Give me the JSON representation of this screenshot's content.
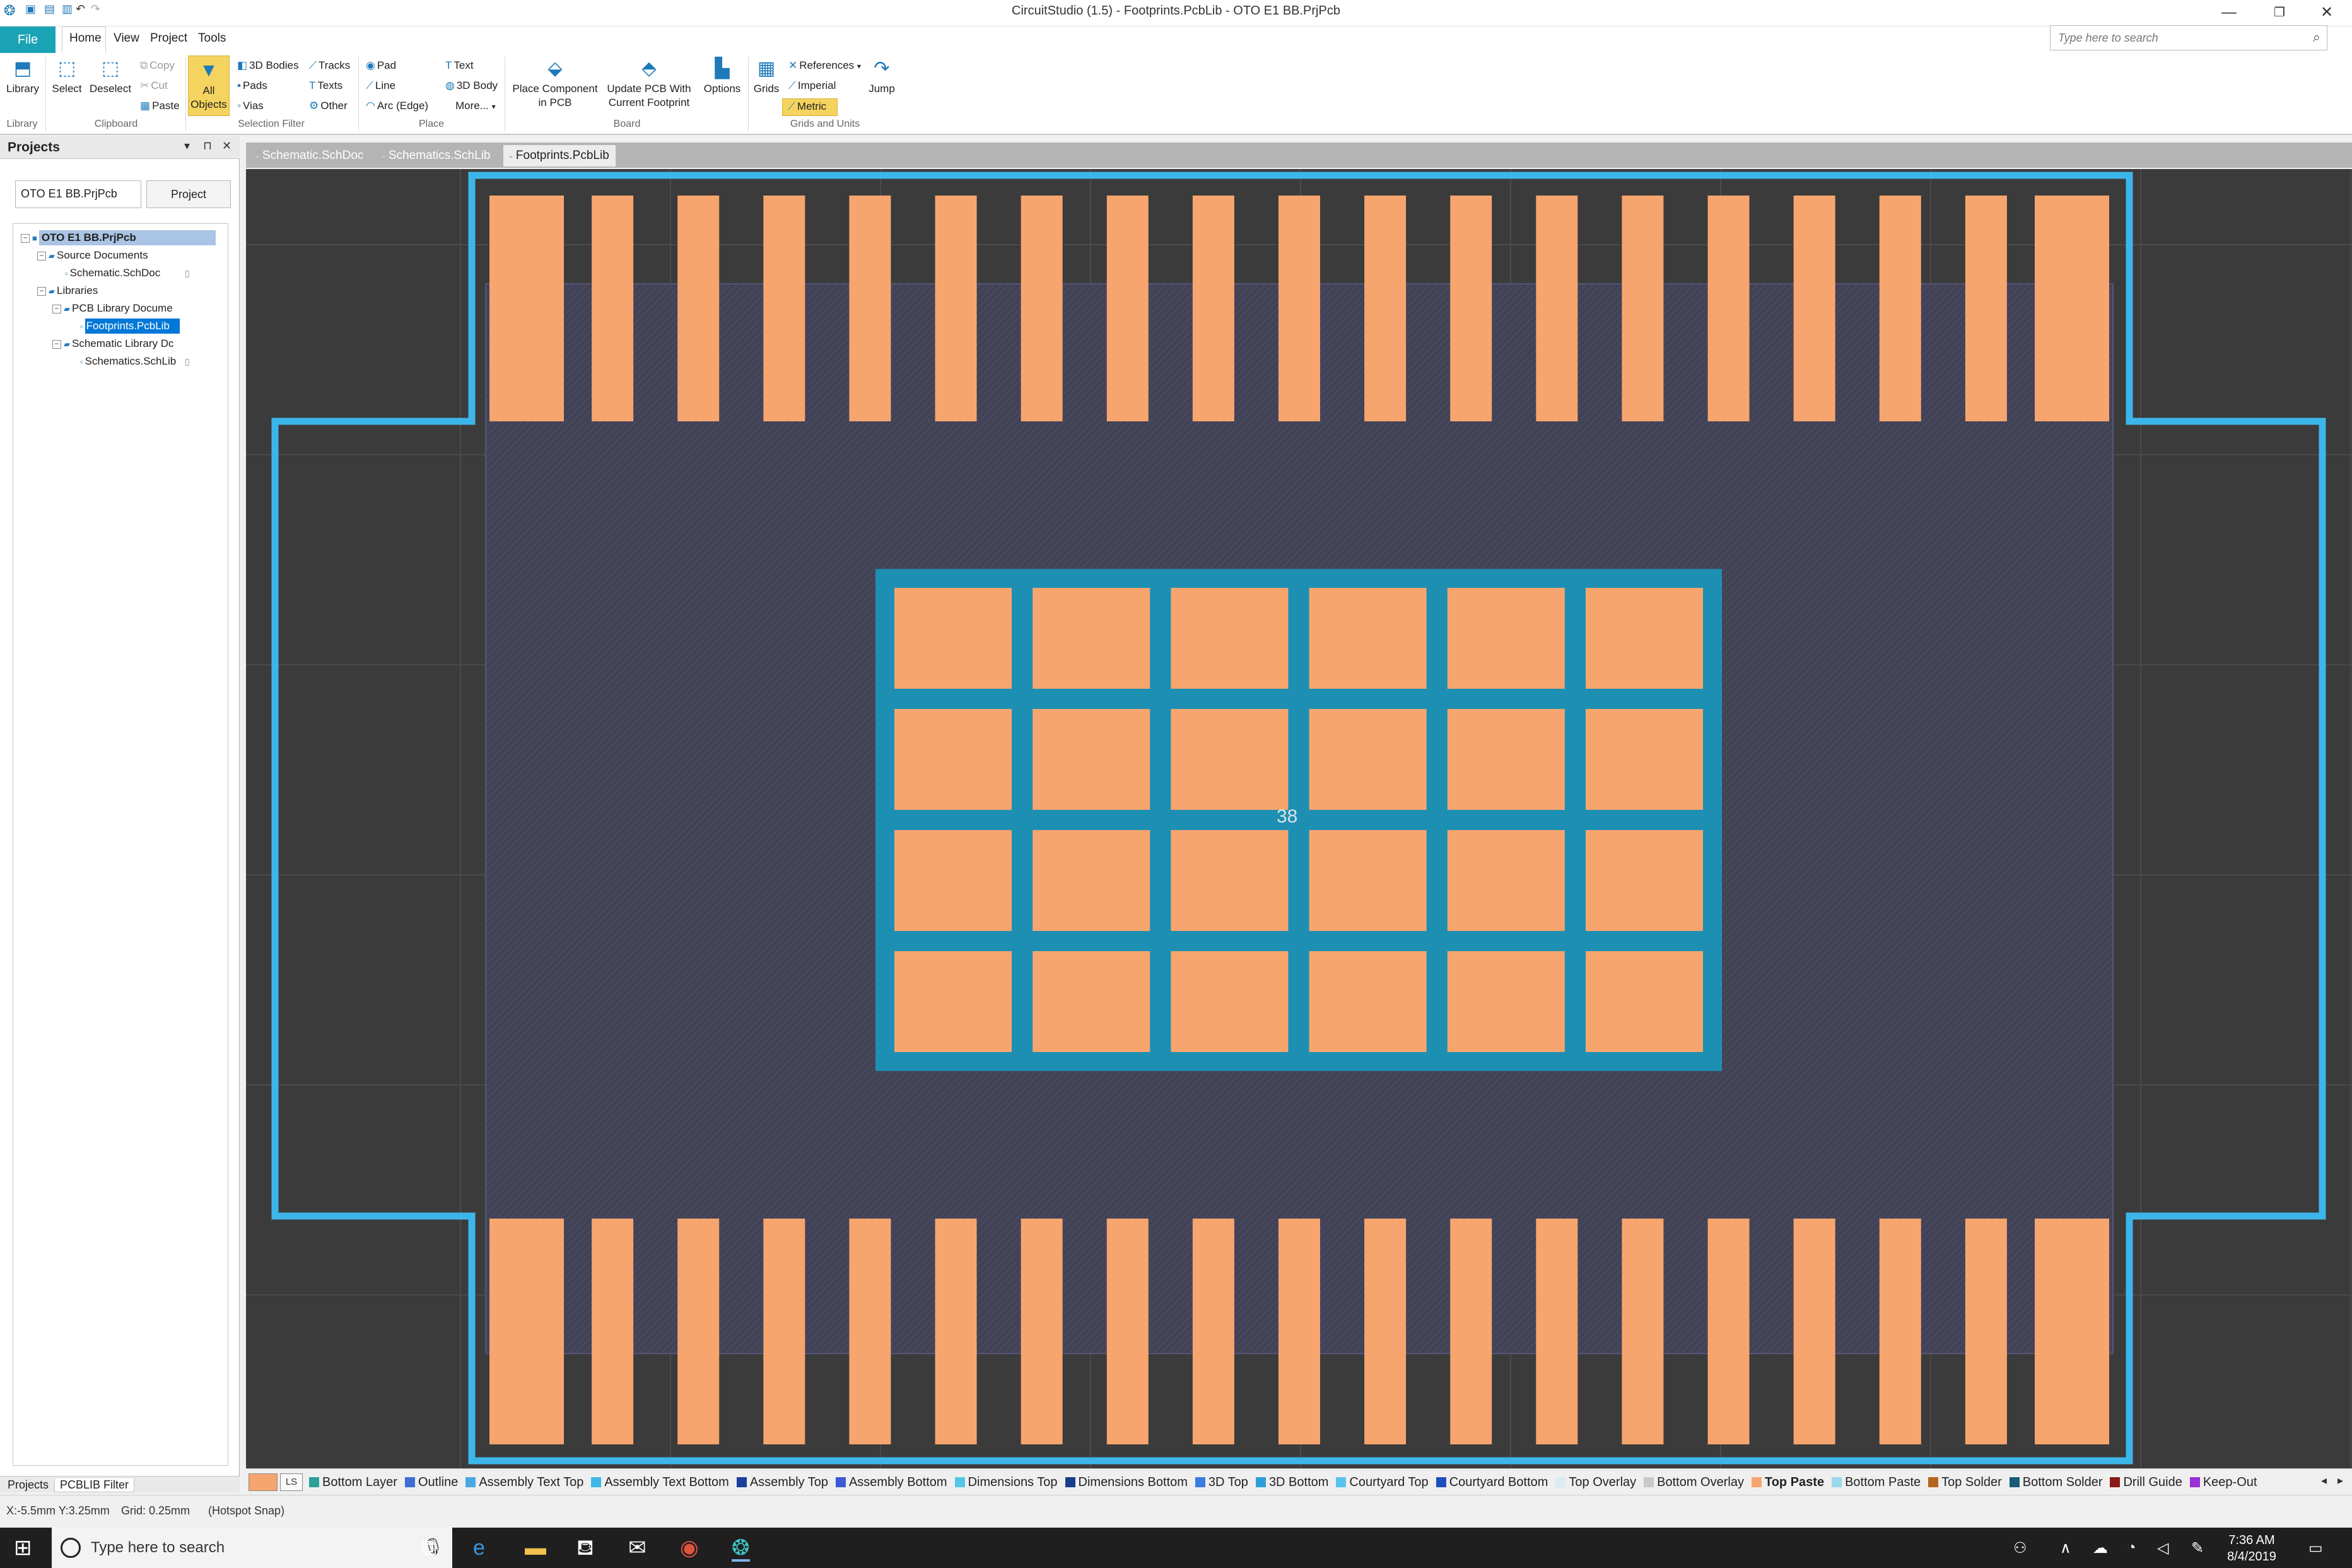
{
  "titlebar": {
    "title": "CircuitStudio (1.5) - Footprints.PcbLib - OTO E1 BB.PrjPcb",
    "minimize": "—",
    "restore": "❐",
    "close": "✕"
  },
  "menu": {
    "file": "File",
    "tabs": [
      "Home",
      "View",
      "Project",
      "Tools"
    ]
  },
  "search": {
    "placeholder": "Type here to search",
    "icon": "search-icon"
  },
  "ribbon": {
    "library": "Library",
    "select": "Select",
    "deselect": "Deselect",
    "copy": "Copy",
    "cut": "Cut",
    "paste": "Paste",
    "all_objects_1": "All",
    "all_objects_2": "Objects",
    "bodies3d": "3D Bodies",
    "pads": "Pads",
    "vias": "Vias",
    "tracks": "Tracks",
    "texts": "Texts",
    "other": "Other",
    "pad": "Pad",
    "line": "Line",
    "arc": "Arc (Edge)",
    "text": "Text",
    "body3d": "3D Body",
    "more": "More...",
    "place_component_1": "Place Component",
    "place_component_2": "in PCB",
    "update_pcb_1": "Update PCB With",
    "update_pcb_2": "Current Footprint",
    "options": "Options",
    "grids": "Grids",
    "references": "References",
    "imperial": "Imperial",
    "metric": "Metric",
    "jump": "Jump",
    "groups": {
      "library": "Library",
      "clipboard": "Clipboard",
      "selection_filter": "Selection Filter",
      "place": "Place",
      "board": "Board",
      "grids_units": "Grids and Units"
    }
  },
  "projects": {
    "title": "Projects",
    "pin": "▾",
    "dock": "⊓",
    "close": "✕",
    "field": "OTO E1 BB.PrjPcb",
    "button": "Project",
    "tree": {
      "root": "OTO E1 BB.PrjPcb",
      "source_docs": "Source Documents",
      "schematic": "Schematic.SchDoc",
      "libraries": "Libraries",
      "pcb_lib_docs": "PCB Library Docume",
      "footprints": "Footprints.PcbLib",
      "sch_lib_docs": "Schematic Library Dc",
      "schematics_lib": "Schematics.SchLib"
    },
    "bottom_tabs": [
      "Projects",
      "PCBLIB Filter"
    ]
  },
  "doc_tabs": [
    "Schematic.SchDoc",
    "Schematics.SchLib",
    "Footprints.PcbLib"
  ],
  "canvas": {
    "center_pad_label": "38",
    "colors": {
      "background": "#3b3b3b",
      "body": "#424256",
      "pad": "#f7a56e",
      "paste": "#1d8fb3",
      "outline": "#3cb6ea",
      "grid": "#4b4b4b"
    },
    "top_pad_count": 19,
    "bottom_pad_count": 19,
    "thermal_grid": {
      "rows": 4,
      "cols": 6
    }
  },
  "layerbar": {
    "ls": "LS",
    "layers": [
      {
        "name": "Bottom Layer",
        "color": "#2aa198"
      },
      {
        "name": "Outline",
        "color": "#3b6fd6"
      },
      {
        "name": "Assembly Text Top",
        "color": "#4aa8e0"
      },
      {
        "name": "Assembly Text Bottom",
        "color": "#3fb7e8"
      },
      {
        "name": "Assembly Top",
        "color": "#1c3f9a"
      },
      {
        "name": "Assembly Bottom",
        "color": "#3b5bd6"
      },
      {
        "name": "Dimensions Top",
        "color": "#54c6e8"
      },
      {
        "name": "Dimensions Bottom",
        "color": "#1a3d8a"
      },
      {
        "name": "3D Top",
        "color": "#3c7be0"
      },
      {
        "name": "3D Bottom",
        "color": "#2e9fd6"
      },
      {
        "name": "Courtyard Top",
        "color": "#59c3ee"
      },
      {
        "name": "Courtyard Bottom",
        "color": "#1f4fbf"
      },
      {
        "name": "Top Overlay",
        "color": "#d8ecf2"
      },
      {
        "name": "Bottom Overlay",
        "color": "#c9c9c9"
      },
      {
        "name": "Top Paste",
        "color": "#f7a56e"
      },
      {
        "name": "Bottom Paste",
        "color": "#9ad8ee"
      },
      {
        "name": "Top Solder",
        "color": "#b5651d"
      },
      {
        "name": "Bottom Solder",
        "color": "#1c5a7a"
      },
      {
        "name": "Drill Guide",
        "color": "#8b1a1a"
      },
      {
        "name": "Keep-Out",
        "color": "#9b30d6"
      }
    ],
    "active": "Top Paste",
    "left_arrow": "◂",
    "right_arrow": "▸"
  },
  "status": {
    "coords": "X:-5.5mm Y:3.25mm",
    "grid": "Grid: 0.25mm",
    "snap": "(Hotspot Snap)"
  },
  "taskbar": {
    "search_placeholder": "Type here to search",
    "time": "7:36 AM",
    "date": "8/4/2019"
  }
}
